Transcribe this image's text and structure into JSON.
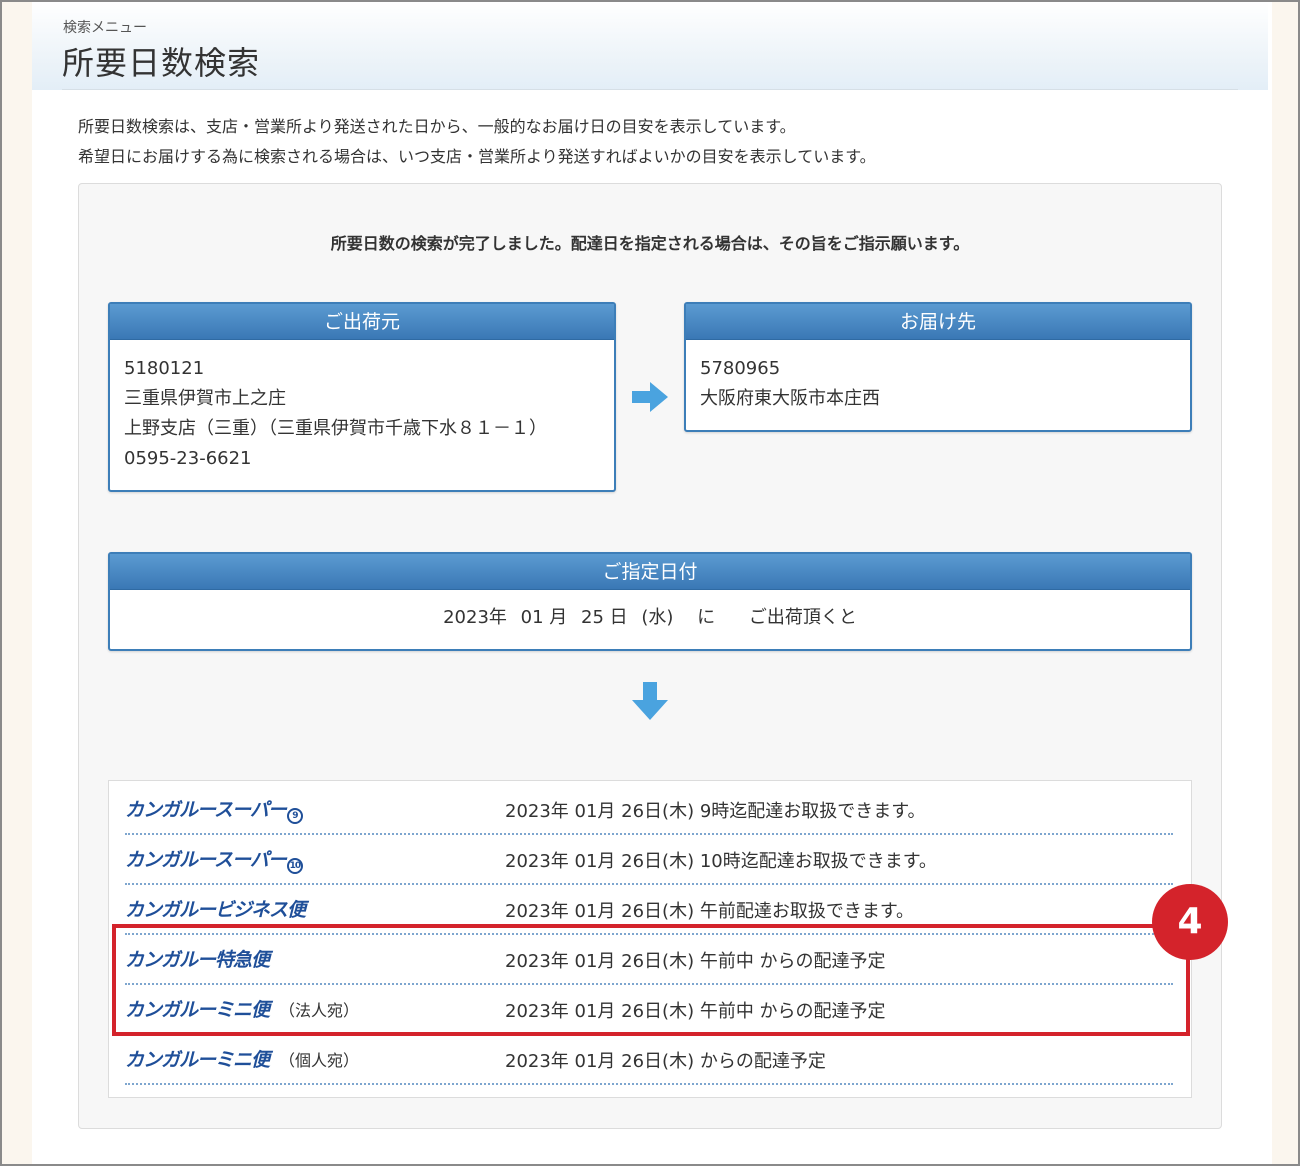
{
  "header": {
    "subtitle": "検索メニュー",
    "title": "所要日数検索"
  },
  "intro": {
    "line1": "所要日数検索は、支店・営業所より発送された日から、一般的なお届け日の目安を表示しています。",
    "line2": "希望日にお届けする為に検索される場合は、いつ支店・営業所より発送すればよいかの目安を表示しています。"
  },
  "complete_message": "所要日数の検索が完了しました。配達日を指定される場合は、その旨をご指示願います。",
  "origin": {
    "heading": "ご出荷元",
    "postal": "5180121",
    "address": "三重県伊賀市上之庄",
    "branch": "上野支店（三重）（三重県伊賀市千歳下水８１－１）",
    "phone": "0595-23-6621"
  },
  "destination": {
    "heading": "お届け先",
    "postal": "5780965",
    "address": "大阪府東大阪市本庄西"
  },
  "date_box": {
    "heading": "ご指定日付",
    "year": "2023年",
    "month": "01 月",
    "day": "25 日",
    "weekday": "(水)",
    "particle": "に",
    "suffix": "ご出荷頂くと"
  },
  "results": [
    {
      "service": "カンガルースーパー",
      "badge": "9",
      "note": "",
      "result": "2023年 01月 26日(木) 9時迄配達お取扱できます。"
    },
    {
      "service": "カンガルースーパー",
      "badge": "10",
      "note": "",
      "result": "2023年 01月 26日(木) 10時迄配達お取扱できます。"
    },
    {
      "service": "カンガルービジネス便",
      "badge": "",
      "note": "",
      "result": "2023年 01月 26日(木) 午前配達お取扱できます。"
    },
    {
      "service": "カンガルー特急便",
      "badge": "",
      "note": "",
      "result": "2023年 01月 26日(木) 午前中 からの配達予定"
    },
    {
      "service": "カンガルーミニ便",
      "badge": "",
      "note": "（法人宛）",
      "result": "2023年 01月 26日(木) 午前中 からの配達予定"
    },
    {
      "service": "カンガルーミニ便",
      "badge": "",
      "note": "（個人宛）",
      "result": "2023年 01月 26日(木)  からの配達予定"
    }
  ],
  "marker": "4",
  "colors": {
    "box_header": "#3d7eb8",
    "arrow": "#4aa3df",
    "service_text": "#1f4f99",
    "highlight": "#d4232b"
  }
}
